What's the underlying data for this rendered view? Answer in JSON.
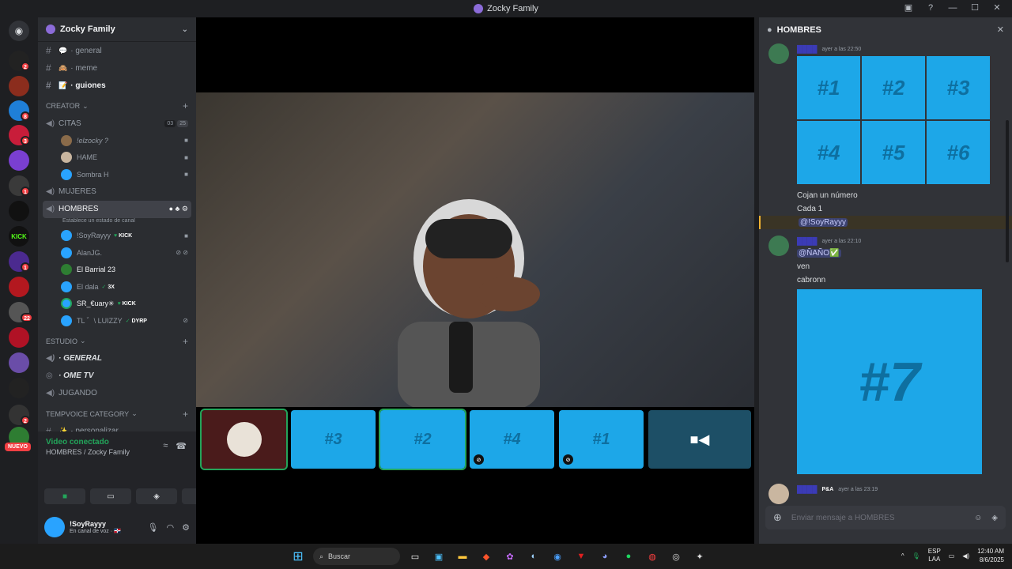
{
  "window": {
    "title": "Zocky Family"
  },
  "rail": {
    "nuevo_label": "NUEVO",
    "badges": [
      "2",
      "8",
      "3",
      "1",
      "1",
      "22",
      "2"
    ]
  },
  "sidebar": {
    "server_name": "Zocky Family",
    "channels": [
      {
        "emoji": "💬",
        "name": "· general"
      },
      {
        "emoji": "🙈",
        "name": "· meme"
      },
      {
        "emoji": "📝",
        "name": "· guiones"
      }
    ],
    "category_creator": "CREATOR",
    "citas": {
      "name": "CITAS",
      "counts": "03",
      "limit": "25"
    },
    "citas_users": [
      "!elzocky ?",
      "HAME",
      "Sombra H"
    ],
    "mujeres": "MUJERES",
    "hombres": {
      "name": "HOMBRES",
      "status_hint": "Establece un estado de canal"
    },
    "hombres_users": [
      {
        "name": "!SoyRayyy",
        "tag": "KICK"
      },
      {
        "name": "AlanJG.",
        "tag": ""
      },
      {
        "name": "El Barrial 23",
        "tag": ""
      },
      {
        "name": "El dala",
        "tag": "3X"
      },
      {
        "name": "SR_€uary✳",
        "tag": "KICK"
      },
      {
        "name": "TL ゛\\ LUIZZY",
        "tag": "DYRP"
      }
    ],
    "category_estudio": "ESTUDIO",
    "estudio_channels": [
      "· GENERAL",
      "· OME TV",
      "JUGANDO"
    ],
    "category_tempvoice": "TEMPVOICE CATEGORY",
    "tempvoice_channel": "· personalizar"
  },
  "voice_panel": {
    "status": "Video conectado",
    "location": "HOMBRES / Zocky Family"
  },
  "user_panel": {
    "username": "!SoyRayyy",
    "status": "En canal de voz · 🇩🇴"
  },
  "stage": {
    "tiles": [
      "#3",
      "#2",
      "#4",
      "#1"
    ]
  },
  "chat": {
    "header": "HOMBRES",
    "messages": [
      {
        "time": "ayer a las 22:50",
        "grid": [
          "#1",
          "#2",
          "#3",
          "#4",
          "#5",
          "#6"
        ],
        "lines": [
          "Cojan un número",
          "Cada 1"
        ],
        "mention": "@!SoyRayyy"
      },
      {
        "time": "ayer a las 22:10",
        "mention": "@ÑAÑO✅",
        "lines": [
          "ven",
          "cabronn"
        ],
        "image_text": "#7"
      },
      {
        "badge": "P&A",
        "time": "ayer a las 23:19"
      }
    ],
    "input_placeholder": "Enviar mensaje a HOMBRES"
  },
  "taskbar": {
    "search_placeholder": "Buscar",
    "lang": "ESP",
    "lang_sub": "LAA",
    "time": "12:40 AM",
    "date": "8/6/2025"
  }
}
